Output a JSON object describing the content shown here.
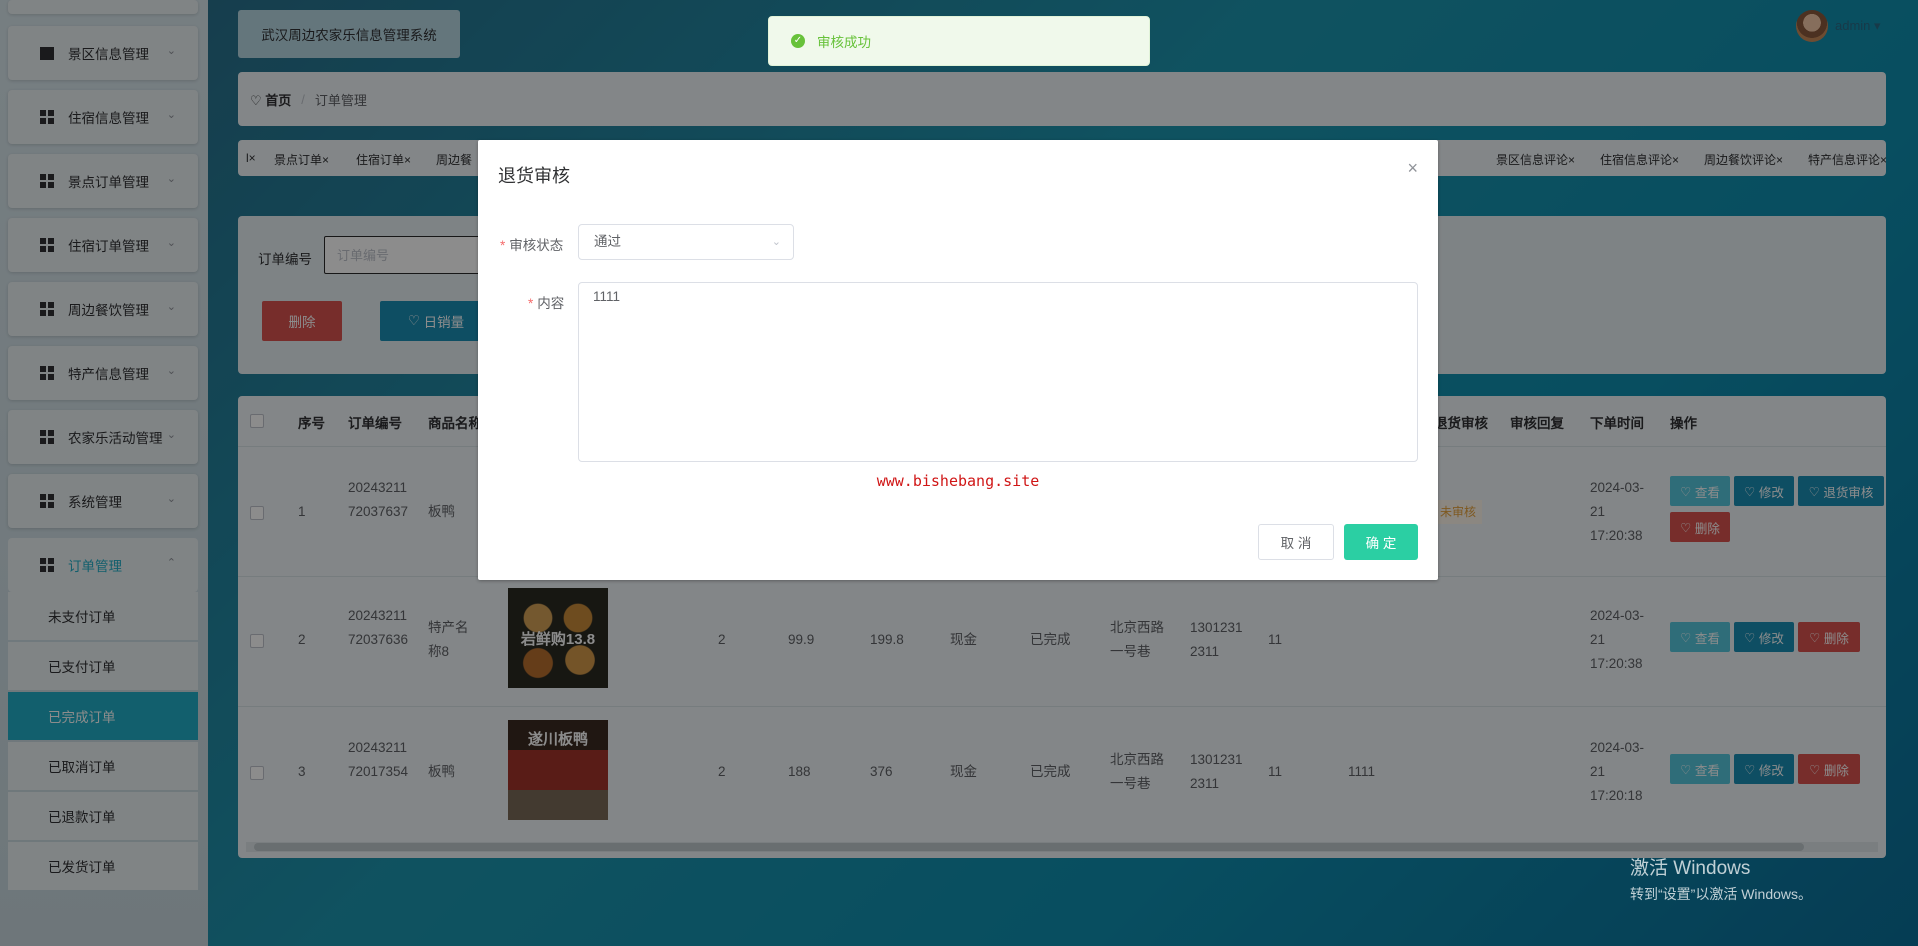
{
  "sidebar": {
    "items": [
      {
        "label": "景区信息管理"
      },
      {
        "label": "住宿信息管理"
      },
      {
        "label": "景点订单管理"
      },
      {
        "label": "住宿订单管理"
      },
      {
        "label": "周边餐饮管理"
      },
      {
        "label": "特产信息管理"
      },
      {
        "label": "农家乐活动管理"
      },
      {
        "label": "系统管理"
      },
      {
        "label": "订单管理"
      }
    ],
    "sub_items": [
      {
        "label": "未支付订单"
      },
      {
        "label": "已支付订单"
      },
      {
        "label": "已完成订单"
      },
      {
        "label": "已取消订单"
      },
      {
        "label": "已退款订单"
      },
      {
        "label": "已发货订单"
      }
    ]
  },
  "header": {
    "system_title": "武汉周边农家乐信息管理系统",
    "user_name": "admin"
  },
  "breadcrumb": {
    "home": "首页",
    "current": "订单管理"
  },
  "tags": [
    "景点订单",
    "住宿订单",
    "周边餐",
    "景区信息评论",
    "住宿信息评论",
    "周边餐饮评论",
    "特产信息评论"
  ],
  "search": {
    "label": "订单编号",
    "placeholder": "订单编号"
  },
  "toolbar": {
    "delete_label": "删除",
    "sales_label": "日销量"
  },
  "table": {
    "headers": [
      "序号",
      "订单编号",
      "商品名称",
      "退货审核",
      "审核回复",
      "下单时间",
      "操作"
    ],
    "rows": [
      {
        "index": "1",
        "order_no": "2024321172037637",
        "name": "板鸭",
        "time": "2024-03-21 17:20:38",
        "status_tag": "未审核"
      },
      {
        "index": "2",
        "order_no": "2024321172037636",
        "name": "特产名称8",
        "qty": "2",
        "price": "99.9",
        "total": "199.8",
        "pay": "现金",
        "state": "已完成",
        "addr": "北京西路一号巷",
        "phone": "13012312311",
        "consignee": "11",
        "reply": "",
        "time": "2024-03-21 17:20:38",
        "thumb_text": "岩鲜购13.8"
      },
      {
        "index": "3",
        "order_no": "2024321172017354",
        "name": "板鸭",
        "qty": "2",
        "price": "188",
        "total": "376",
        "pay": "现金",
        "state": "已完成",
        "addr": "北京西路一号巷",
        "phone": "13012312311",
        "consignee": "11",
        "reply": "1111",
        "time": "2024-03-21 17:20:18",
        "thumb_text": "遂川板鸭"
      }
    ],
    "actions": {
      "view": "查看",
      "edit": "修改",
      "return_audit": "退货审核",
      "delete": "删除"
    }
  },
  "toast": {
    "message": "审核成功"
  },
  "dialog": {
    "title": "退货审核",
    "status_label": "审核状态",
    "status_value": "通过",
    "content_label": "内容",
    "content_value": "1111",
    "watermark": "www.bishebang.site",
    "cancel_label": "取 消",
    "ok_label": "确 定"
  },
  "windows_watermark": {
    "line1": "激活 Windows",
    "line2": "转到“设置”以激活 Windows。"
  }
}
